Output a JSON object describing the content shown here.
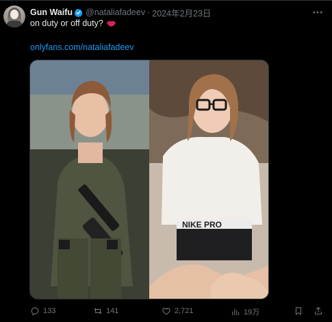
{
  "tweet": {
    "author": {
      "display_name": "Gun Waifu",
      "handle": "@nataliafadeev",
      "verified": true
    },
    "separator": "·",
    "date": "2024年2月23日",
    "text": "on duty or off duty?",
    "link_text": "onlyfans.com/nataliafadeev"
  },
  "actions": {
    "replies": "133",
    "reposts": "141",
    "likes": "2,721",
    "views": "19万"
  },
  "icons": {
    "verified": "verified-badge-icon",
    "more": "more-icon",
    "reply": "reply-icon",
    "repost": "repost-icon",
    "like": "like-icon",
    "views": "views-icon",
    "bookmark": "bookmark-icon",
    "share": "share-icon"
  },
  "colors": {
    "background": "#000000",
    "text": "#e7e9ea",
    "muted": "#71767b",
    "link": "#1d9bf0",
    "verified": "#1d9bf0"
  }
}
